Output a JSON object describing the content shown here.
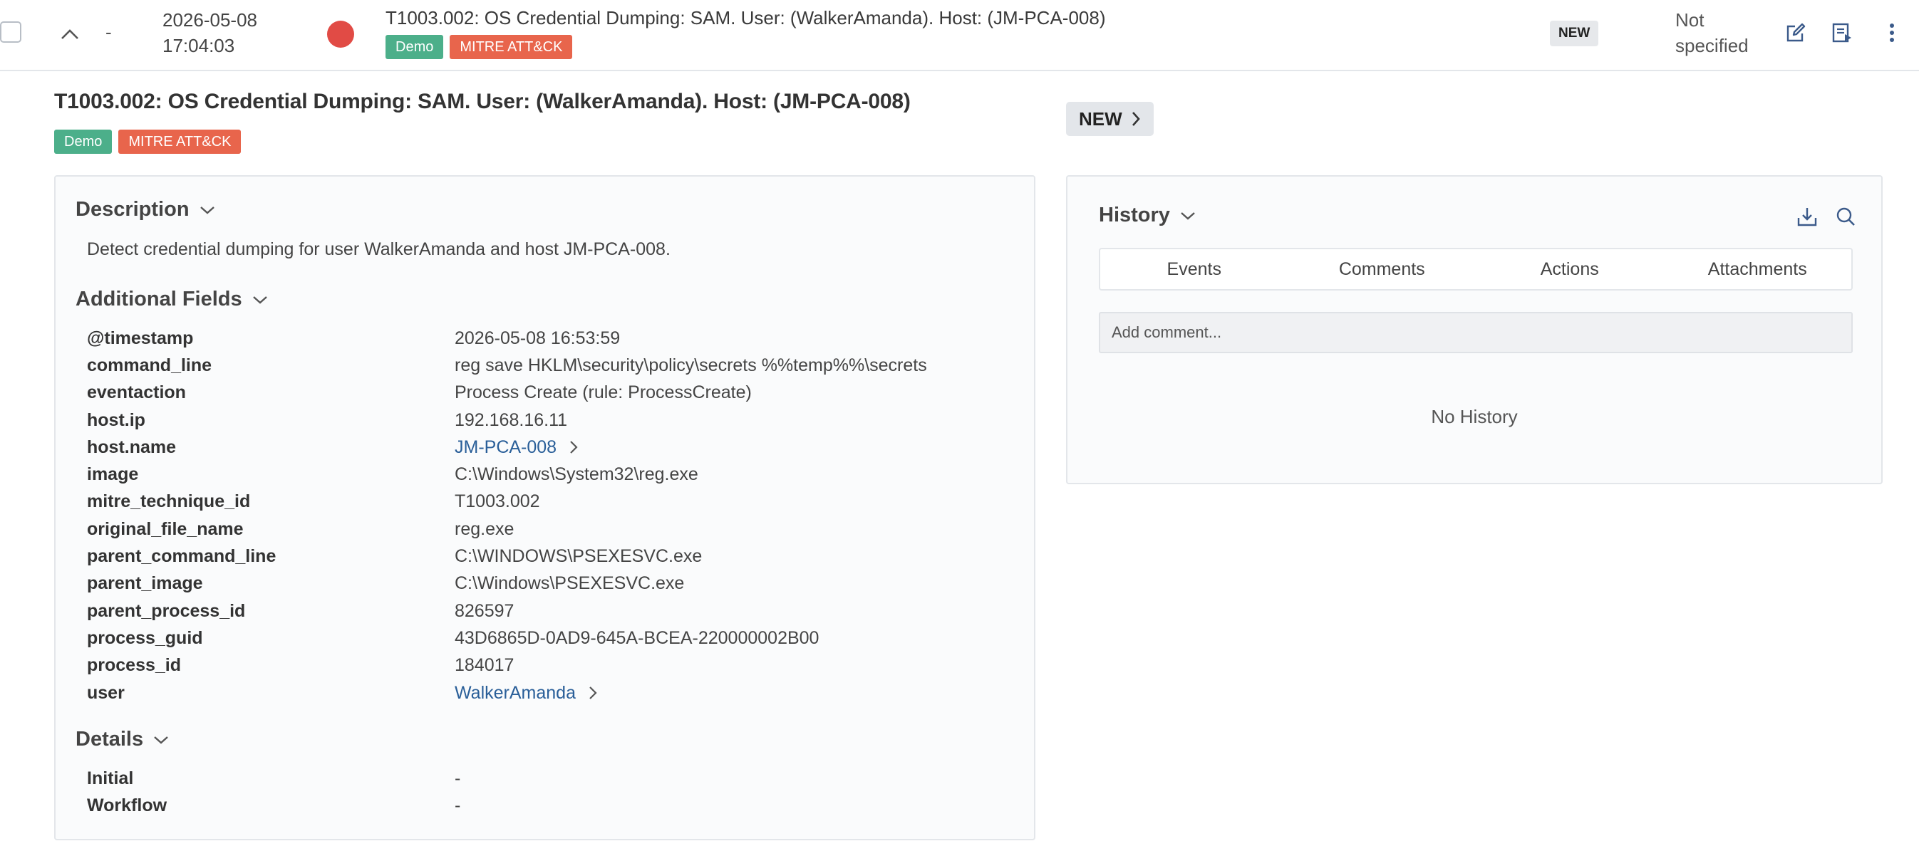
{
  "top_row": {
    "collapse_icon": "chevron-up-icon",
    "dash": "-",
    "date": "2026-05-08",
    "time": "17:04:03",
    "severity_color": "#e14b45",
    "title": "T1003.002: OS Credential Dumping: SAM. User: (WalkerAmanda). Host: (JM-PCA-008)",
    "tags": [
      "Demo",
      "MITRE ATT&CK"
    ],
    "status": "NEW",
    "assignee_line1": "Not",
    "assignee_line2": "specified",
    "icons": [
      "edit-icon",
      "run-playbook-icon",
      "more-vertical-icon"
    ]
  },
  "detail": {
    "title": "T1003.002: OS Credential Dumping: SAM. User: (WalkerAmanda). Host: (JM-PCA-008)",
    "tags": [
      "Demo",
      "MITRE ATT&CK"
    ],
    "status_button": "NEW"
  },
  "description": {
    "heading": "Description",
    "text": "Detect credential dumping for user WalkerAmanda and host JM-PCA-008."
  },
  "additional_fields": {
    "heading": "Additional Fields",
    "rows": [
      {
        "key": "@timestamp",
        "value": "2026-05-08 16:53:59"
      },
      {
        "key": "command_line",
        "value": "reg save HKLM\\security\\policy\\secrets %%temp%%\\secrets"
      },
      {
        "key": "eventaction",
        "value": "Process Create (rule: ProcessCreate)"
      },
      {
        "key": "host.ip",
        "value": "192.168.16.11"
      },
      {
        "key": "host.name",
        "value": "JM-PCA-008"
      },
      {
        "key": "image",
        "value": "C:\\Windows\\System32\\reg.exe"
      },
      {
        "key": "mitre_technique_id",
        "value": "T1003.002"
      },
      {
        "key": "original_file_name",
        "value": "reg.exe"
      },
      {
        "key": "parent_command_line",
        "value": "C:\\WINDOWS\\PSEXESVC.exe"
      },
      {
        "key": "parent_image",
        "value": "C:\\Windows\\PSEXESVC.exe"
      },
      {
        "key": "parent_process_id",
        "value": "826597"
      },
      {
        "key": "process_guid",
        "value": "43D6865D-0AD9-645A-BCEA-220000002B00"
      },
      {
        "key": "process_id",
        "value": "184017"
      },
      {
        "key": "user",
        "value": "WalkerAmanda"
      }
    ]
  },
  "details": {
    "heading": "Details",
    "rows": [
      {
        "key": "Initial",
        "value": "-"
      },
      {
        "key": "Workflow",
        "value": "-"
      }
    ]
  },
  "history": {
    "heading": "History",
    "tabs": [
      "Events",
      "Comments",
      "Actions",
      "Attachments"
    ],
    "comment_placeholder": "Add comment...",
    "empty_text": "No History"
  },
  "colors": {
    "accent_link": "#2a5f99",
    "tag_demo": "#4caf8a",
    "tag_mitre": "#e8654c",
    "severity_high": "#e14b45"
  }
}
